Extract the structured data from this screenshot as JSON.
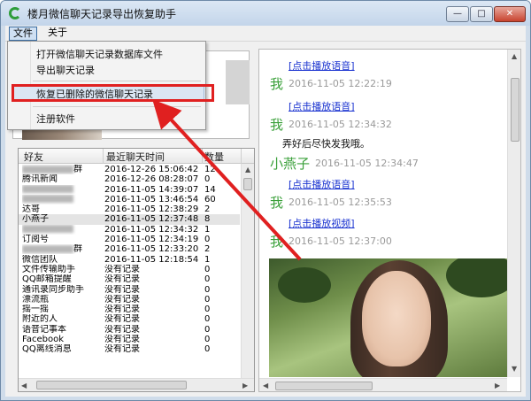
{
  "window": {
    "title": "楼月微信聊天记录导出恢复助手",
    "buttons": {
      "minimize": "—",
      "maximize": "□",
      "close": "✕"
    }
  },
  "menubar": {
    "file": "文件",
    "about": "关于"
  },
  "file_menu": {
    "items": [
      "打开微信聊天记录数据库文件",
      "导出聊天记录",
      "恢复已删除的微信聊天记录",
      "注册软件"
    ],
    "highlighted_index": 2
  },
  "table": {
    "headers": [
      "好友",
      "最近聊天时间",
      "数量"
    ],
    "rows": [
      {
        "friend": "群",
        "time": "2016-12-26 15:06:42",
        "count": "12",
        "friend_blurred": true
      },
      {
        "friend": "腾讯新闻",
        "time": "2016-12-26 08:28:07",
        "count": "0",
        "friend_blurred": false
      },
      {
        "friend": "",
        "time": "2016-11-05 14:39:07",
        "count": "14",
        "friend_blurred": true
      },
      {
        "friend": "",
        "time": "2016-11-05 13:46:54",
        "count": "60",
        "friend_blurred": true
      },
      {
        "friend": "达哥",
        "time": "2016-11-05 12:38:29",
        "count": "2",
        "friend_blurred": false
      },
      {
        "friend": "小燕子",
        "time": "2016-11-05 12:37:48",
        "count": "8",
        "friend_blurred": false
      },
      {
        "friend": "",
        "time": "2016-11-05 12:34:32",
        "count": "1",
        "friend_blurred": true
      },
      {
        "friend": "订阅号",
        "time": "2016-11-05 12:34:19",
        "count": "0",
        "friend_blurred": false
      },
      {
        "friend": "群",
        "time": "2016-11-05 12:33:20",
        "count": "2",
        "friend_blurred": true
      },
      {
        "friend": "微信团队",
        "time": "2016-11-05 12:18:54",
        "count": "1",
        "friend_blurred": false
      },
      {
        "friend": "文件传输助手",
        "time": "没有记录",
        "count": "0",
        "friend_blurred": false
      },
      {
        "friend": "QQ邮箱提醒",
        "time": "没有记录",
        "count": "0",
        "friend_blurred": false
      },
      {
        "friend": "通讯录同步助手",
        "time": "没有记录",
        "count": "0",
        "friend_blurred": false
      },
      {
        "friend": "漂流瓶",
        "time": "没有记录",
        "count": "0",
        "friend_blurred": false
      },
      {
        "friend": "摇一摇",
        "time": "没有记录",
        "count": "0",
        "friend_blurred": false
      },
      {
        "friend": "附近的人",
        "time": "没有记录",
        "count": "0",
        "friend_blurred": false
      },
      {
        "friend": "语音记事本",
        "time": "没有记录",
        "count": "0",
        "friend_blurred": false
      },
      {
        "friend": "Facebook",
        "time": "没有记录",
        "count": "0",
        "friend_blurred": false
      },
      {
        "friend": "QQ离线消息",
        "time": "没有记录",
        "count": "0",
        "friend_blurred": false
      }
    ],
    "selected_row": 5
  },
  "chat": {
    "link_voice": "[点击播放语音]",
    "link_video": "[点击播放视频]",
    "entries": [
      {
        "sender": "我",
        "time": "2016-11-05 12:22:19"
      },
      {
        "sender": "我",
        "time": "2016-11-05 12:34:32",
        "message": "弄好后尽快发我哦。"
      },
      {
        "sender": "小燕子",
        "time": "2016-11-05 12:34:47"
      },
      {
        "sender": "我",
        "time": "2016-11-05 12:35:53"
      },
      {
        "sender": "我",
        "time": "2016-11-05 12:37:00"
      }
    ]
  },
  "colors": {
    "annotation": "#e02020",
    "sender": "#3aa03a",
    "link": "#1a33d0",
    "timestamp": "#9a9a9a"
  }
}
